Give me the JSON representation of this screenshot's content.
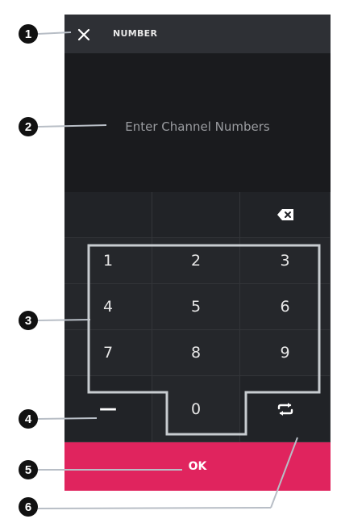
{
  "header": {
    "title": "NUMBER",
    "close_icon": "close-icon"
  },
  "display": {
    "placeholder": "Enter Channel Numbers",
    "value": ""
  },
  "keypad": {
    "backspace_icon": "backspace-icon",
    "rows": [
      [
        "1",
        "2",
        "3"
      ],
      [
        "4",
        "5",
        "6"
      ],
      [
        "7",
        "8",
        "9"
      ]
    ],
    "dash_label": "—",
    "zero_label": "0",
    "swap_icon": "swap-icon"
  },
  "ok_button": {
    "label": "OK"
  },
  "callouts": [
    "1",
    "2",
    "3",
    "4",
    "5",
    "6"
  ],
  "colors": {
    "panel": "#2b2d31",
    "display": "#1a1b1e",
    "ok": "#e0245e",
    "highlight": "#c8ccd0"
  }
}
